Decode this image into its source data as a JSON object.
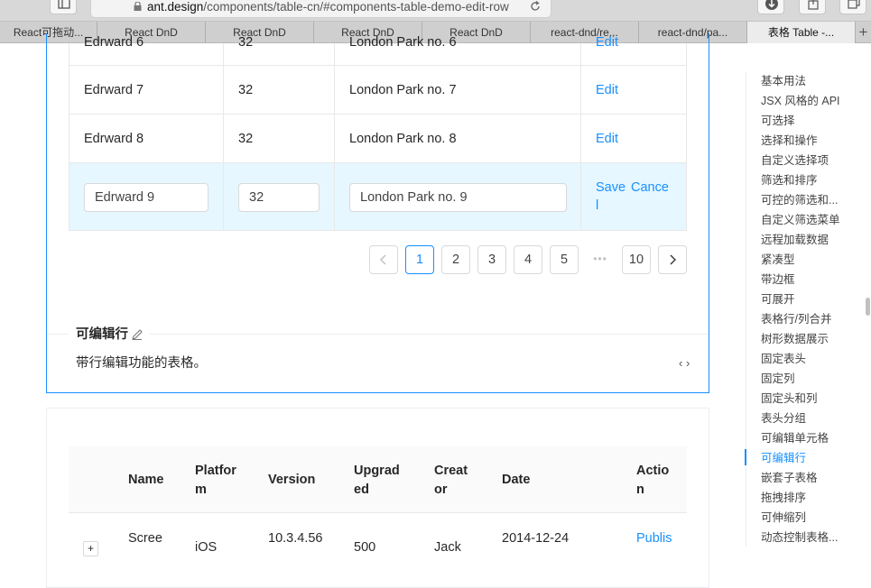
{
  "browser": {
    "url_host": "ant.design",
    "url_path": "/components/table-cn/#components-table-demo-edit-row",
    "tabs": [
      {
        "label": "React可拖动..."
      },
      {
        "label": "React DnD"
      },
      {
        "label": "React DnD"
      },
      {
        "label": "React DnD"
      },
      {
        "label": "React DnD"
      },
      {
        "label": "react-dnd/re..."
      },
      {
        "label": "react-dnd/pa..."
      },
      {
        "label": "表格 Table -..."
      }
    ],
    "new_tab_label": "+"
  },
  "table": {
    "rows": [
      {
        "name": "Edrward 6",
        "age": "32",
        "address": "London Park no. 6",
        "action": "Edit"
      },
      {
        "name": "Edrward 7",
        "age": "32",
        "address": "London Park no. 7",
        "action": "Edit"
      },
      {
        "name": "Edrward 8",
        "age": "32",
        "address": "London Park no. 8",
        "action": "Edit"
      }
    ],
    "editing_row": {
      "name_value": "Edrward 9",
      "age_value": "32",
      "address_value": "London Park no. 9",
      "save_label": "Save",
      "cancel_label_line1": "Cance",
      "cancel_label_line2": "l"
    }
  },
  "pagination": {
    "prev_label": "<",
    "pages": [
      "1",
      "2",
      "3",
      "4",
      "5"
    ],
    "ellipsis": "•••",
    "last_page": "10",
    "next_label": ">",
    "current": "1"
  },
  "demo_meta": {
    "title": "可编辑行",
    "description": "带行编辑功能的表格。",
    "code_toggle": "‹ ›"
  },
  "table2": {
    "headers": {
      "name": "Name",
      "platform_1": "Platfor",
      "platform_2": "m",
      "version": "Version",
      "upgraded_1": "Upgrad",
      "upgraded_2": "ed",
      "creator_1": "Creat",
      "creator_2": "or",
      "date": "Date",
      "action_1": "Actio",
      "action_2": "n"
    },
    "first_row": {
      "expand": "+",
      "name": "Scree",
      "platform": "iOS",
      "version": "10.3.4.56",
      "upgraded": "500",
      "creator": "Jack",
      "date": "2014-12-24",
      "action": "Publis"
    }
  },
  "toc": {
    "items": [
      "基本用法",
      "JSX 风格的 API",
      "可选择",
      "选择和操作",
      "自定义选择项",
      "筛选和排序",
      "可控的筛选和...",
      "自定义筛选菜单",
      "远程加载数据",
      "紧凑型",
      "带边框",
      "可展开",
      "表格行/列合并",
      "树形数据展示",
      "固定表头",
      "固定列",
      "固定头和列",
      "表头分组",
      "可编辑单元格",
      "可编辑行",
      "嵌套子表格",
      "拖拽排序",
      "可伸缩列",
      "动态控制表格..."
    ],
    "active_index": 19
  },
  "colors": {
    "accent": "#1890ff",
    "editing_row_bg": "#e6f7ff",
    "border": "#e8e8e8"
  }
}
